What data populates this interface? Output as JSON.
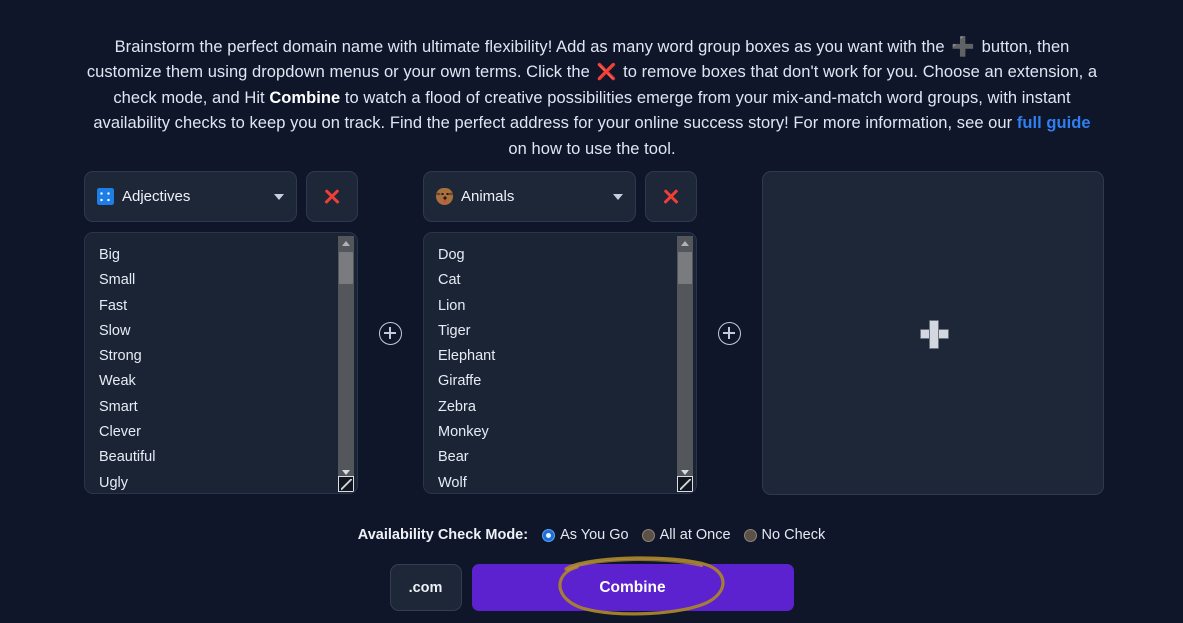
{
  "intro": {
    "part1": "Brainstorm the perfect domain name with ultimate flexibility! Add as many word group boxes as you want with the",
    "plus_icon": "plus-icon",
    "part2": "button, then customize them using dropdown menus or your own terms. Click the",
    "x_icon": "x-icon",
    "part3": "to remove boxes that don't work for you. Choose an extension, a check mode, and Hit",
    "bold_word": "Combine",
    "part4": "to watch a flood of creative possibilities emerge from your mix-and-match word groups, with instant availability checks to keep you on track. Find the perfect address for your online success story! For more information, see our",
    "link_text": "full guide",
    "part5": "on how to use the tool."
  },
  "groups": [
    {
      "icon": "abc-blue-square-icon",
      "category": "Adjectives",
      "remove_label": "x-icon",
      "words": [
        "Big",
        "Small",
        "Fast",
        "Slow",
        "Strong",
        "Weak",
        "Smart",
        "Clever",
        "Beautiful",
        "Ugly"
      ]
    },
    {
      "icon": "dog-face-icon",
      "category": "Animals",
      "remove_label": "x-icon",
      "words": [
        "Dog",
        "Cat",
        "Lion",
        "Tiger",
        "Elephant",
        "Giraffe",
        "Zebra",
        "Monkey",
        "Bear",
        "Wolf"
      ]
    }
  ],
  "add_group_placeholder": {
    "icon": "plus-icon",
    "name": "add-word-group-box"
  },
  "add_between_buttons": [
    {
      "name": "insert-group-after-1",
      "icon": "circle-plus-icon"
    },
    {
      "name": "insert-group-after-2",
      "icon": "circle-plus-icon"
    }
  ],
  "check_mode": {
    "label": "Availability Check Mode:",
    "options": [
      {
        "label": "As You Go",
        "checked": true
      },
      {
        "label": "All at Once",
        "checked": false
      },
      {
        "label": "No Check",
        "checked": false
      }
    ]
  },
  "actions": {
    "extension_selected": ".com",
    "combine_label": "Combine"
  },
  "annotation": {
    "shape": "hand-drawn-ellipse",
    "target": "Combine"
  },
  "colors": {
    "page_background": "#0f1629",
    "panel": "#1d2738",
    "textarea": "#1b2435",
    "accent_purple": "#5c22cf",
    "link_blue": "#2f7ff0",
    "remove_red": "#ef3e36",
    "radio_checked": "#1d6fdc",
    "annotation_ochre": "#a8842c"
  }
}
